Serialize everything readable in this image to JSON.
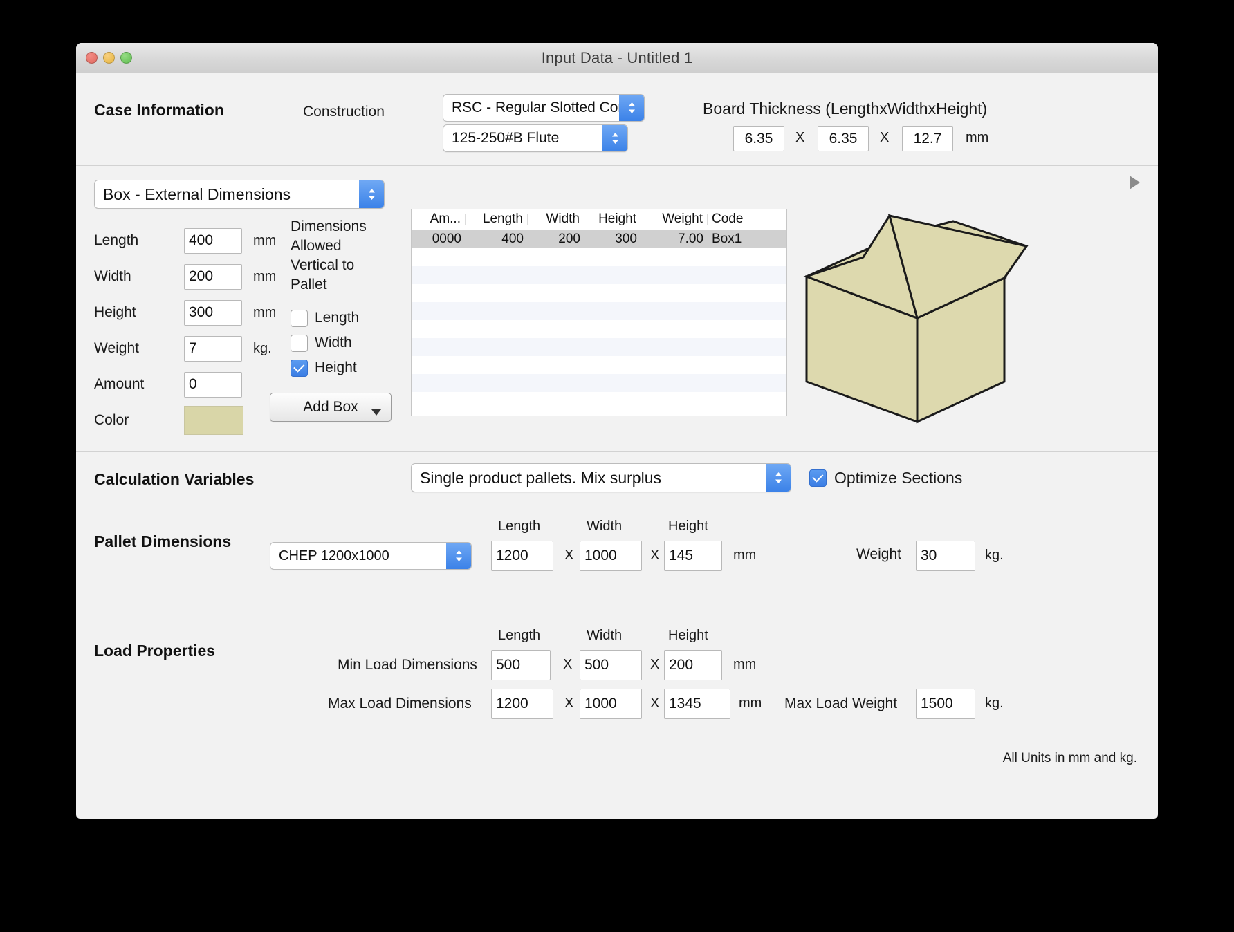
{
  "window": {
    "title": "Input Data - Untitled 1",
    "traffic_lights": [
      "close",
      "minimize",
      "zoom"
    ]
  },
  "case_information": {
    "title": "Case Information",
    "construction_label": "Construction",
    "construction_value": "RSC - Regular Slotted Container",
    "flute_value": "125-250#B Flute",
    "board_thickness_label": "Board Thickness (LengthxWidthxHeight)",
    "thickness_length": "6.35",
    "thickness_width": "6.35",
    "thickness_height": "12.7",
    "x_sep": "X",
    "unit_mm": "mm"
  },
  "box_section": {
    "mode_value": "Box - External Dimensions",
    "fields": [
      {
        "label": "Length",
        "value": "400",
        "unit": "mm"
      },
      {
        "label": "Width",
        "value": "200",
        "unit": "mm"
      },
      {
        "label": "Height",
        "value": "300",
        "unit": "mm"
      },
      {
        "label": "Weight",
        "value": "7",
        "unit": "kg."
      },
      {
        "label": "Amount",
        "value": "0",
        "unit": ""
      }
    ],
    "color_label": "Color",
    "color_swatch": "#d9d6a8",
    "add_box_label": "Add Box",
    "allowed_title_lines": [
      "Dimensions",
      "Allowed",
      "Vertical to",
      "Pallet"
    ],
    "allowed": [
      {
        "label": "Length",
        "checked": false
      },
      {
        "label": "Width",
        "checked": false
      },
      {
        "label": "Height",
        "checked": true
      }
    ],
    "table": {
      "columns": [
        "Am...",
        "Length",
        "Width",
        "Height",
        "Weight",
        "Code"
      ],
      "rows": [
        {
          "amount": "0000",
          "length": "400",
          "width": "200",
          "height": "300",
          "weight": "7.00",
          "code": "Box1"
        }
      ],
      "empty_row_count": 9
    }
  },
  "calculation_variables": {
    "title": "Calculation Variables",
    "mode_value": "Single product pallets. Mix surplus",
    "optimize_sections_label": "Optimize Sections",
    "optimize_sections_checked": true
  },
  "pallet_dimensions": {
    "title": "Pallet Dimensions",
    "pallet_type": "CHEP 1200x1000",
    "col_length": "Length",
    "col_width": "Width",
    "col_height": "Height",
    "length": "1200",
    "width": "1000",
    "height": "145",
    "x_sep": "X",
    "unit_mm": "mm",
    "weight_label": "Weight",
    "weight": "30",
    "weight_unit": "kg."
  },
  "load_properties": {
    "title": "Load Properties",
    "col_length": "Length",
    "col_width": "Width",
    "col_height": "Height",
    "x_sep": "X",
    "unit_mm": "mm",
    "min_label": "Min Load Dimensions",
    "min_length": "500",
    "min_width": "500",
    "min_height": "200",
    "max_label": "Max Load Dimensions",
    "max_length": "1200",
    "max_width": "1000",
    "max_height": "1345",
    "max_weight_label": "Max Load Weight",
    "max_weight": "1500",
    "max_weight_unit": "kg."
  },
  "footer": {
    "units_note": "All Units in mm and kg."
  },
  "preview": {
    "box_fill": "#ddd9ae",
    "box_stroke": "#1b1b1b"
  }
}
